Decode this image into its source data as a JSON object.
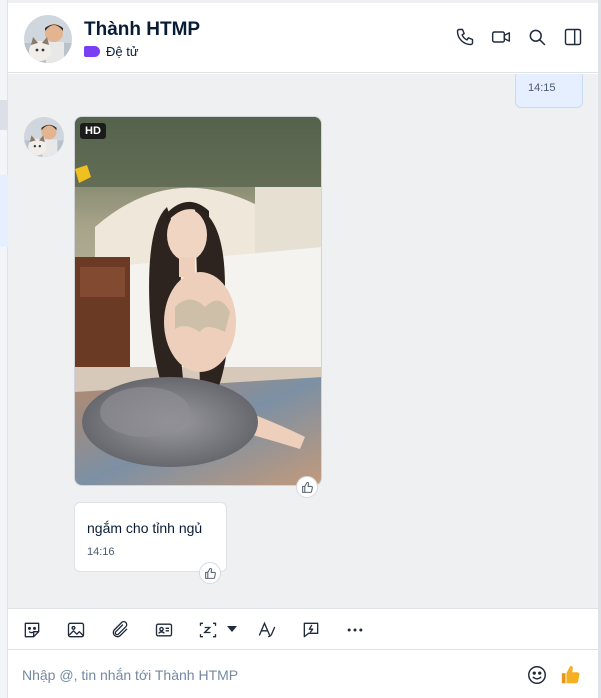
{
  "header": {
    "contact_name": "Thành HTMP",
    "label": "Đệ tử",
    "label_color": "#7a3ff2"
  },
  "header_actions": [
    "phone-icon",
    "video-call-icon",
    "search-icon",
    "sidebar-toggle-icon"
  ],
  "messages": {
    "outgoing_time": "14:15",
    "image_badge": "HD",
    "incoming_text": "ngắm cho tỉnh ngủ",
    "incoming_time": "14:16"
  },
  "toolbar_icons": [
    "sticker-icon",
    "image-icon",
    "attachment-icon",
    "contact-card-icon",
    "screenshot-icon",
    "text-format-icon",
    "quick-message-icon",
    "more-icon"
  ],
  "composer": {
    "placeholder": "Nhập @, tin nhắn tới Thành HTMP",
    "emoji_icon": "emoji-icon",
    "quick_reaction_icon": "thumbs-up-icon"
  },
  "colors": {
    "accent": "#0068ff",
    "outgoing_bubble": "#e5efff",
    "chat_background": "#eef0f1",
    "thumbs_up": "#f5a623"
  }
}
